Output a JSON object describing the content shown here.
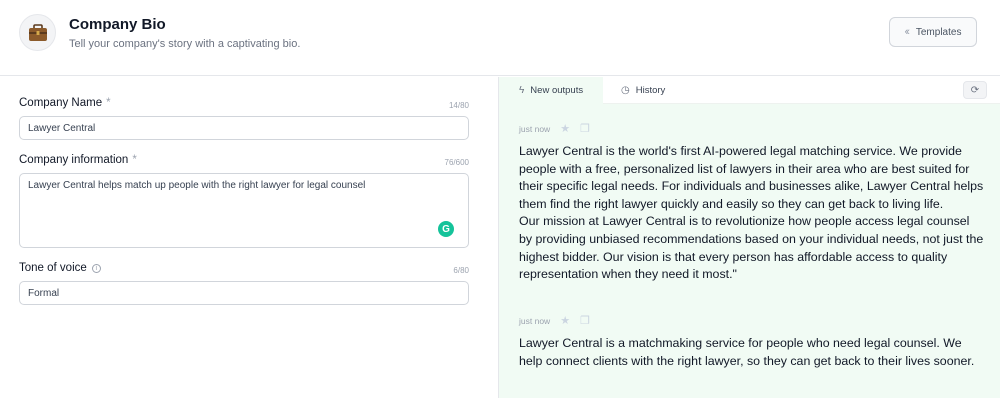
{
  "header": {
    "title": "Company Bio",
    "subtitle": "Tell your company's story with a captivating bio.",
    "templates_label": "Templates"
  },
  "form": {
    "company_name": {
      "label": "Company Name",
      "required_mark": "*",
      "counter": "14/80",
      "value": "Lawyer Central"
    },
    "company_info": {
      "label": "Company information",
      "required_mark": "*",
      "counter": "76/600",
      "value": "Lawyer Central helps match up people with the right lawyer for legal counsel"
    },
    "tone": {
      "label": "Tone of voice",
      "counter": "6/80",
      "value": "Formal"
    }
  },
  "output_panel": {
    "tabs": [
      {
        "label": "New outputs",
        "icon": "bolt-icon"
      },
      {
        "label": "History",
        "icon": "clock-icon"
      }
    ],
    "outputs": [
      {
        "time": "just now",
        "paragraphs": [
          "Lawyer Central is the world's first AI-powered legal matching service. We provide people with a free, personalized list of lawyers in their area who are best suited for their specific legal needs. For individuals and businesses alike, Lawyer Central helps them find the right lawyer quickly and easily so they can get back to living life.",
          "Our mission at Lawyer Central is to revolutionize how people access legal counsel by providing unbiased recommendations based on your individual needs, not just the highest bidder. Our vision is that every person has affordable access to quality representation when they need it most.\""
        ]
      },
      {
        "time": "just now",
        "paragraphs": [
          "Lawyer Central is a matchmaking service for people who need legal counsel. We help connect clients with the right lawyer, so they can get back to their lives sooner."
        ]
      }
    ]
  },
  "colors": {
    "accent_green": "#15c39a",
    "output_bg": "#f1fbf4"
  }
}
